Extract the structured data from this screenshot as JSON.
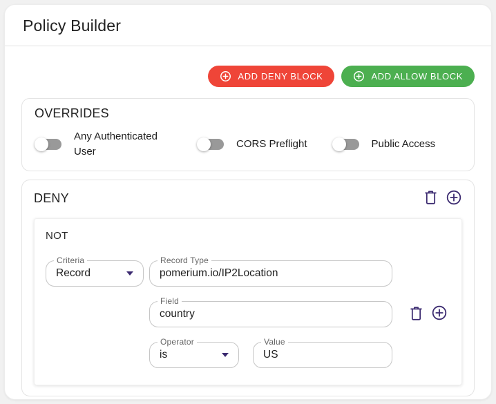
{
  "title": "Policy Builder",
  "toolbar": {
    "add_deny_label": "ADD DENY BLOCK",
    "add_allow_label": "ADD ALLOW BLOCK"
  },
  "overrides": {
    "title": "OVERRIDES",
    "toggles": [
      {
        "label": "Any Authenticated User",
        "state": "off"
      },
      {
        "label": "CORS Preflight",
        "state": "off"
      },
      {
        "label": "Public Access",
        "state": "off"
      }
    ]
  },
  "deny_block": {
    "title": "DENY",
    "group_label": "NOT",
    "criteria": {
      "label": "Criteria",
      "value": "Record"
    },
    "record_type": {
      "label": "Record Type",
      "value": "pomerium.io/IP2Location"
    },
    "field": {
      "label": "Field",
      "value": "country"
    },
    "operator": {
      "label": "Operator",
      "value": "is"
    },
    "value": {
      "label": "Value",
      "value": "US"
    }
  },
  "icons": {
    "add_circle": "plus-in-circle",
    "trash": "trash-can-outline",
    "dropdown": "caret-down"
  },
  "colors": {
    "deny_button": "#ef4538",
    "allow_button": "#4caf50",
    "icon_purple": "#3b2a70",
    "toggle_track": "#999999",
    "page_bg": "#f1f1f1"
  }
}
